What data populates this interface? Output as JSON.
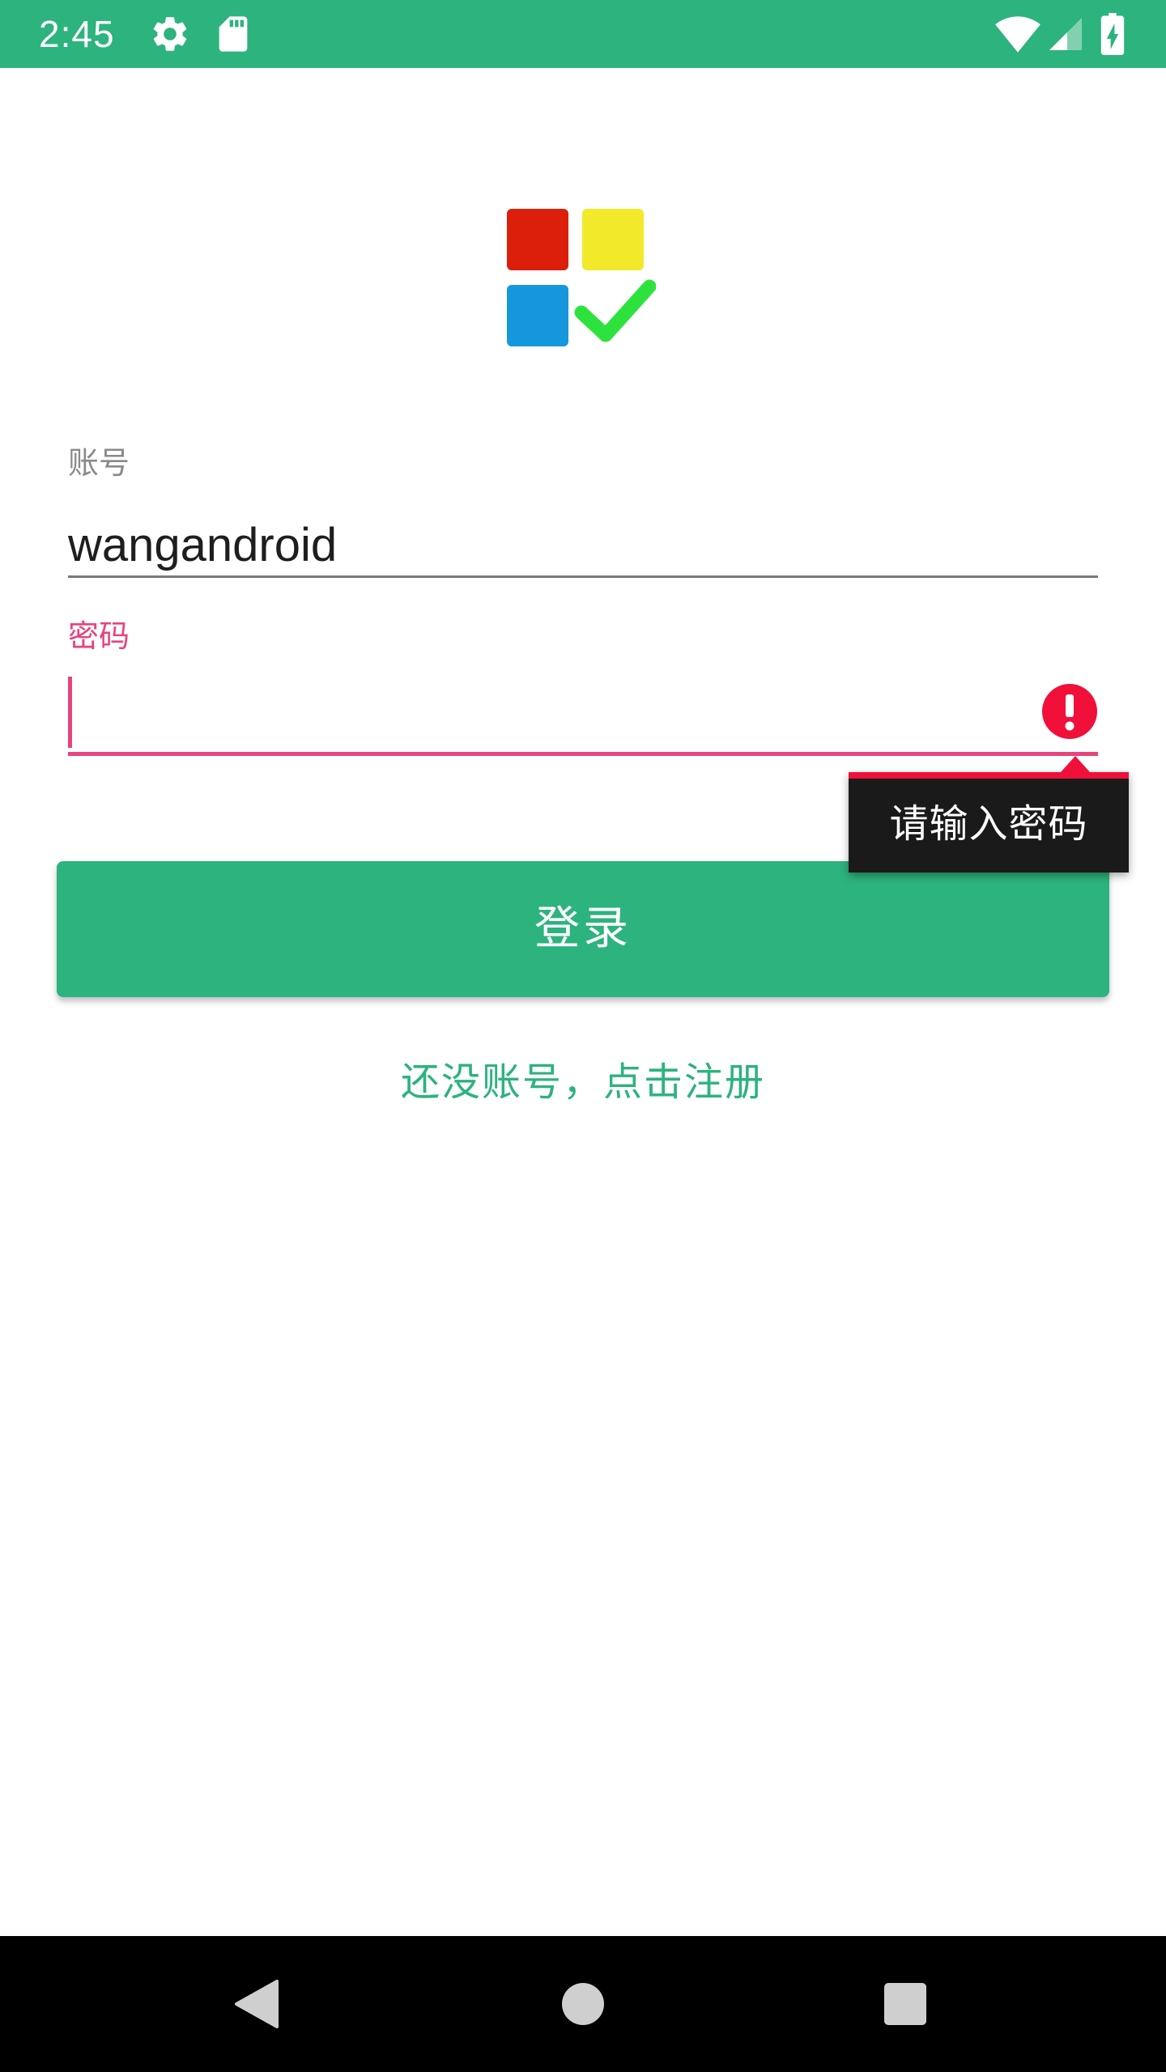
{
  "status_bar": {
    "time": "2:45",
    "icons": [
      "settings-icon",
      "sd-card-icon",
      "wifi-icon",
      "signal-icon",
      "battery-charging-icon"
    ],
    "background_color": "#2db37d"
  },
  "logo": {
    "name": "app-logo",
    "colors": {
      "red": "#dc1f0b",
      "yellow": "#f2e92b",
      "blue": "#1596dd",
      "check": "#2ee23e"
    }
  },
  "form": {
    "account": {
      "label": "账号",
      "value": "wangandroid"
    },
    "password": {
      "label": "密码",
      "value": "",
      "error_message": "请输入密码"
    }
  },
  "login_button": {
    "label": "登录"
  },
  "register_link": {
    "label": "还没账号，点击注册"
  },
  "colors": {
    "accent": "#2db37d",
    "error": "#e8437e",
    "error_icon": "#f0103a"
  },
  "nav_bar": {
    "buttons": [
      "back-icon",
      "home-icon",
      "recents-icon"
    ]
  }
}
